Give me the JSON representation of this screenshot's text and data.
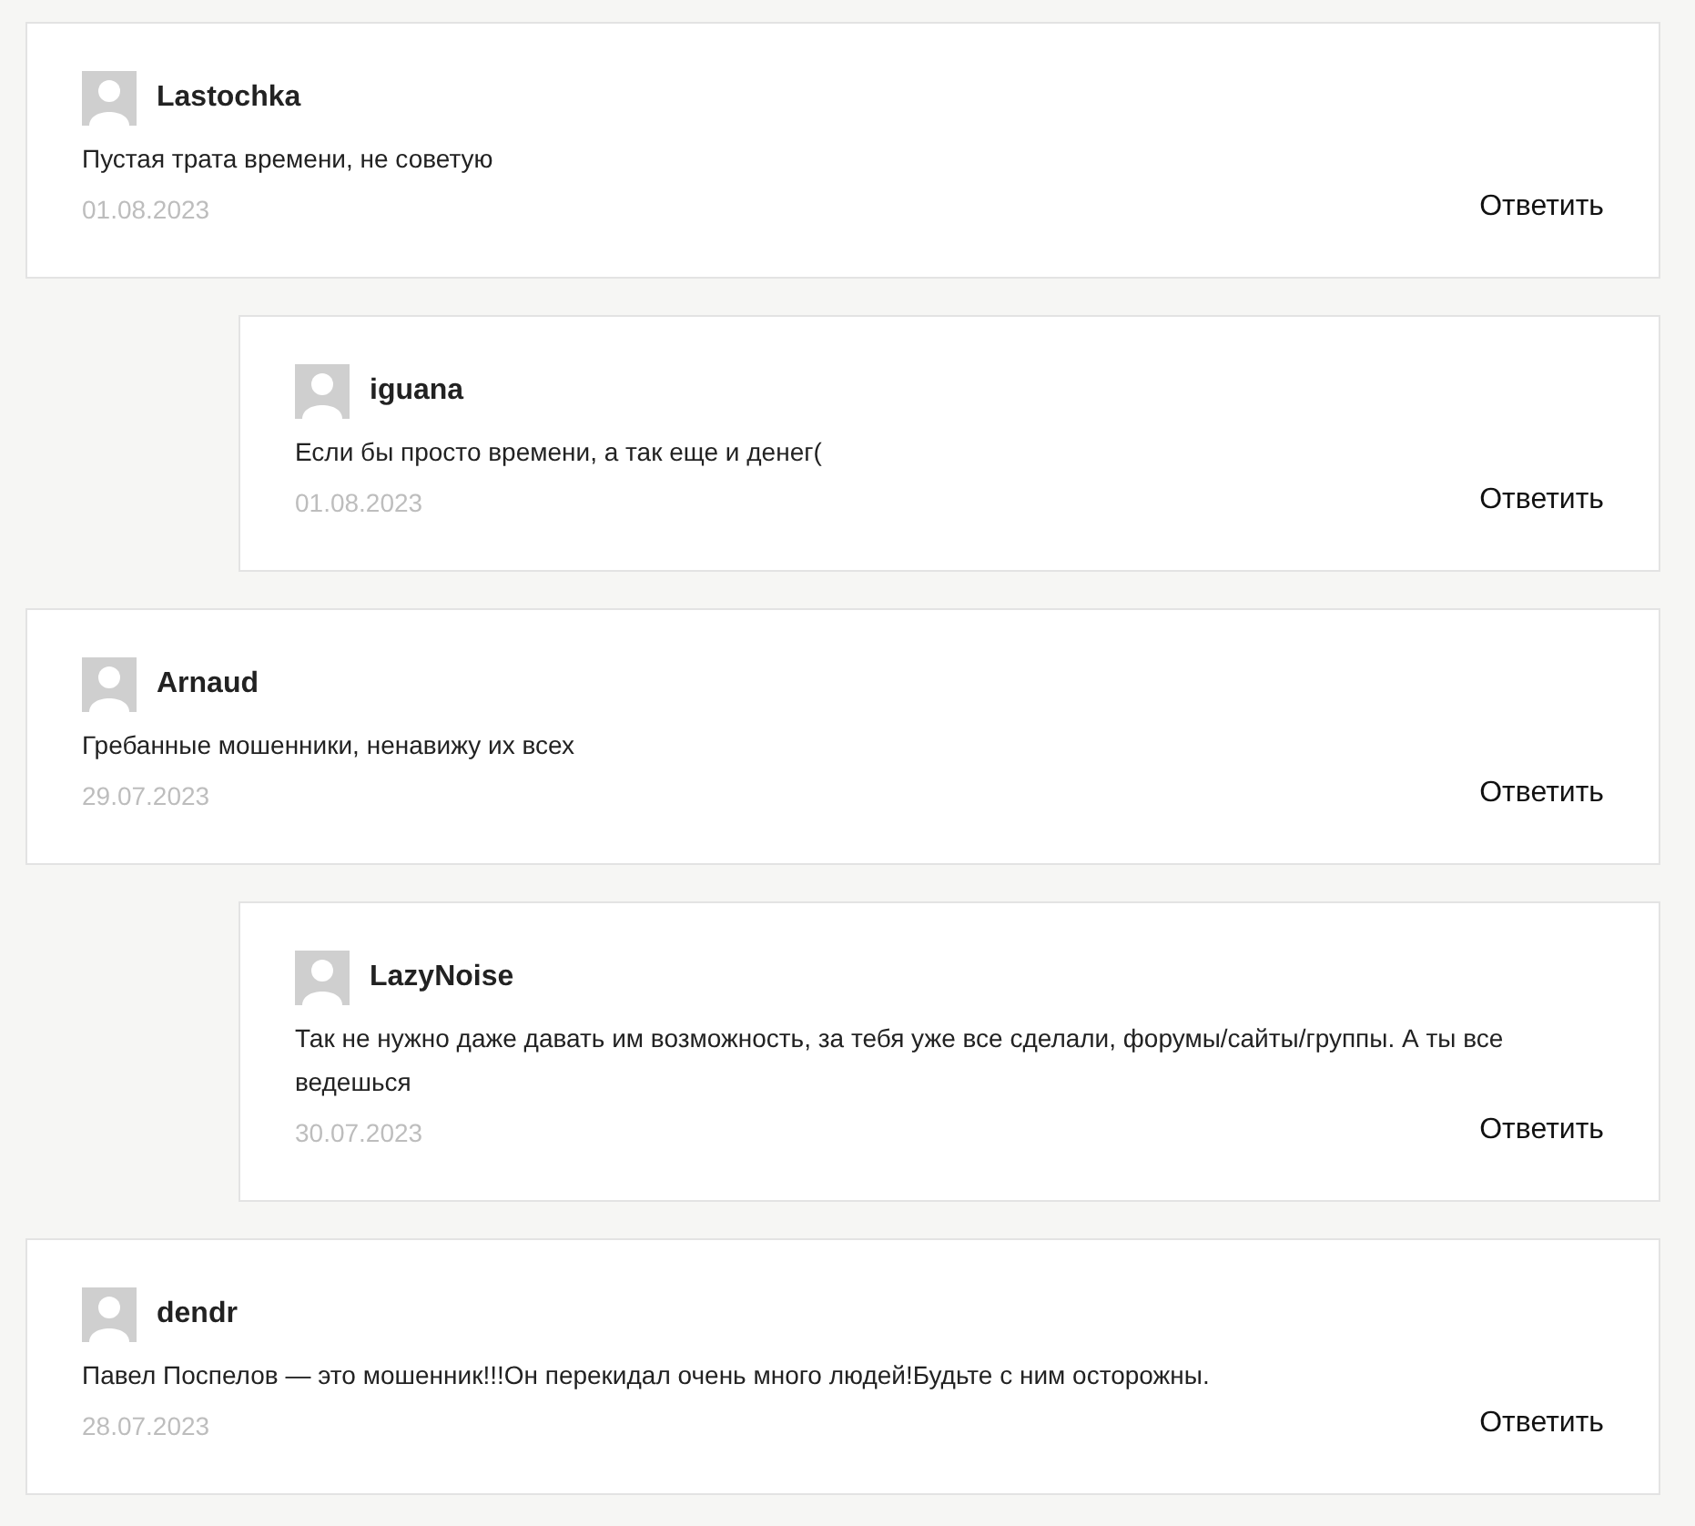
{
  "comments": [
    {
      "author": "Lastochka",
      "text": "Пустая трата времени, не советую",
      "date": "01.08.2023",
      "reply_label": "Ответить",
      "children": [
        {
          "author": "iguana",
          "text": "Если бы просто времени, а так еще и денег(",
          "date": "01.08.2023",
          "reply_label": "Ответить"
        }
      ]
    },
    {
      "author": "Arnaud",
      "text": "Гребанные мошенники, ненавижу их всех",
      "date": "29.07.2023",
      "reply_label": "Ответить",
      "children": [
        {
          "author": "LazyNoise",
          "text": "Так не нужно даже давать им возможность, за тебя уже все сделали, форумы/сайты/группы. А ты все ведешься",
          "date": "30.07.2023",
          "reply_label": "Ответить"
        }
      ]
    },
    {
      "author": "dendr",
      "text": "Павел Поспелов — это мошенник!!!Он перекидал очень много людей!Будьте с ним осторожны.",
      "date": "28.07.2023",
      "reply_label": "Ответить"
    }
  ]
}
